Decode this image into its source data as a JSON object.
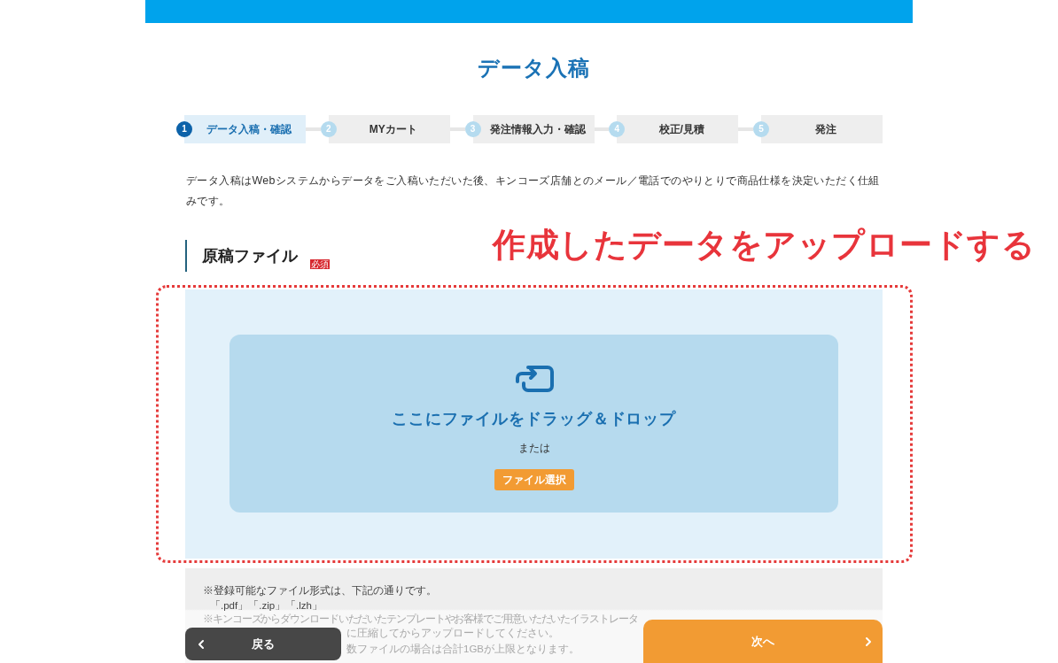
{
  "page_title": "データ入稿",
  "steps": [
    {
      "number": "1",
      "label": "データ入稿・確認",
      "selected": true
    },
    {
      "number": "2",
      "label": "MYカート",
      "selected": false
    },
    {
      "number": "3",
      "label": "発注情報入力・確認",
      "selected": false
    },
    {
      "number": "4",
      "label": "校正/見積",
      "selected": false
    },
    {
      "number": "5",
      "label": "発注",
      "selected": false
    }
  ],
  "intro": "データ入稿はWebシステムからデータをご入稿いただいた後、キンコーズ店舗とのメール／電話でのやりとりで商品仕様を決定いただく仕組みです。",
  "section": {
    "title": "原稿ファイル",
    "badge": "必須"
  },
  "annotation": {
    "text": "作成したデータをアップロードする"
  },
  "dropzone": {
    "title": "ここにファイルをドラッグ＆ドロップ",
    "separator": "または",
    "button": "ファイル選択"
  },
  "notes": [
    {
      "kind": "plain",
      "text": "※登録可能なファイル形式は、下記の通りです。"
    },
    {
      "kind": "format",
      "text": "「.pdf」「.zip」「.lzh」"
    },
    {
      "kind": "faded",
      "text": "※キンコーズからダウンロードいただいたテンプレートやお客様でご用意いただいたイラストレータ"
    },
    {
      "kind": "faded_partial",
      "text": "に圧縮してからアップロードしてください。"
    },
    {
      "kind": "faded_partial",
      "text": "数ファイルの場合は合計1GBが上限となります。"
    }
  ],
  "footer": {
    "back": "戻る",
    "next": "次へ"
  }
}
